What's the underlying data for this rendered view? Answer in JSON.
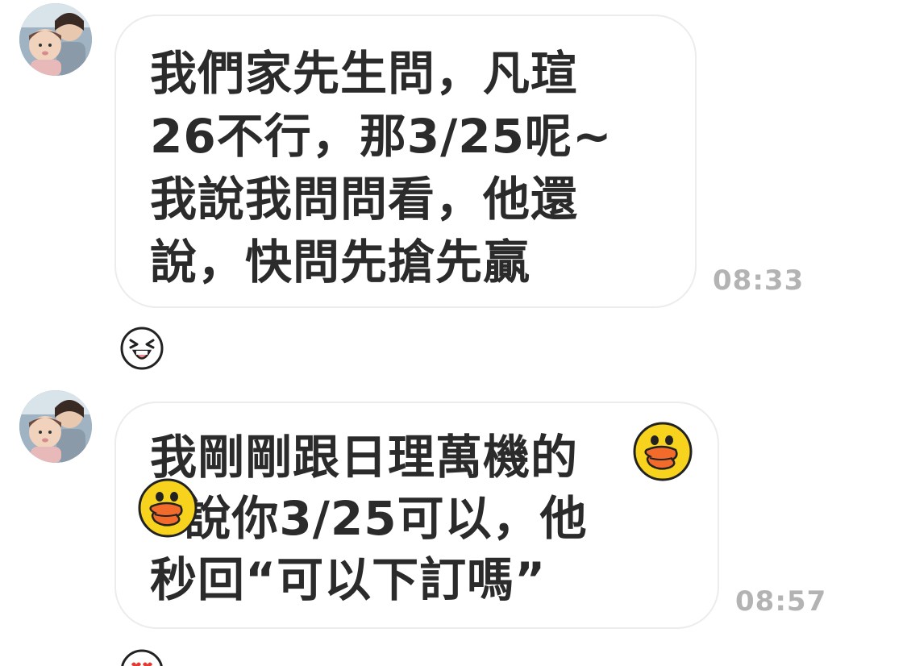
{
  "messages": [
    {
      "lines": [
        "我們家先生問，凡瑄",
        "26不行，那3/25呢~",
        "我說我問問看，他還",
        "說，快問先搶先贏"
      ],
      "time": "08:33",
      "reaction": "laughing-face-icon"
    },
    {
      "lines": [
        "我剛剛跟日理萬機的",
        "  說你3/25可以，他",
        "秒回“可以下訂嗎”"
      ],
      "time": "08:57",
      "stickers": [
        "sally-duck-emoji",
        "sally-duck-emoji"
      ],
      "reaction": "heart-eyes-face-icon"
    }
  ],
  "colors": {
    "bubble_border": "#ececec",
    "text": "#2b2b2b",
    "time": "#b3b3b3",
    "duck_yellow": "#f7d31d",
    "duck_beak": "#f36b2b"
  }
}
